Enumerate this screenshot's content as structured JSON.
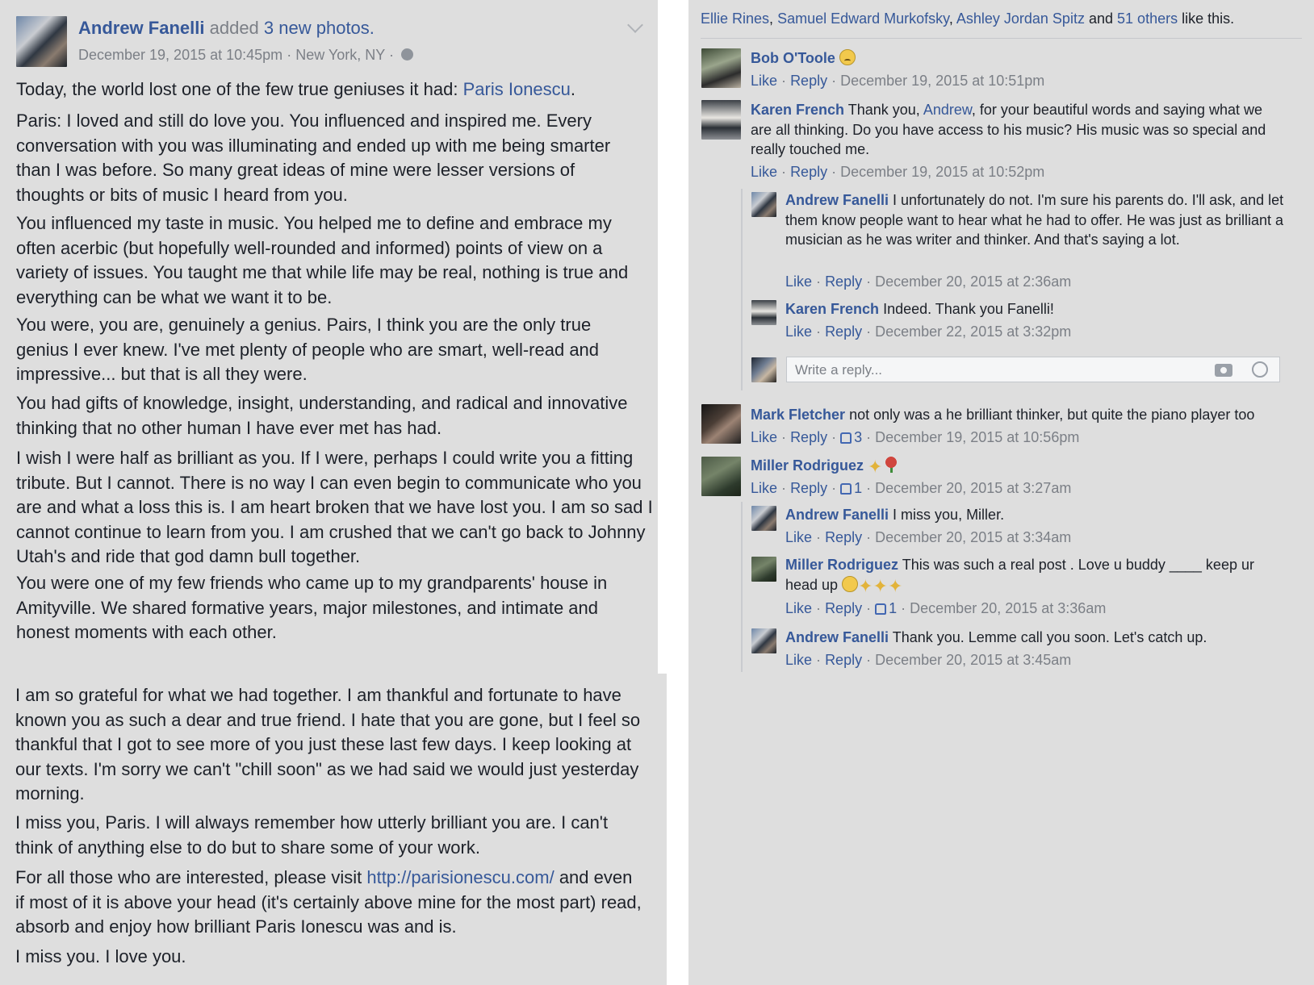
{
  "post": {
    "author": "Andrew Fanelli",
    "action_text": "added",
    "photos_text": "3 new photos.",
    "date": "December 19, 2015 at 10:45pm",
    "location": "New York, NY",
    "separator": "·",
    "paragraphs": {
      "p1_text": "Today, the world lost one of the few true geniuses it had:",
      "p1_link": "Paris Ionescu",
      "p1_end": ".",
      "p2": "Paris: I loved and still do love you. You influenced and inspired me. Every conversation with you was illuminating and ended up with me being smarter than I was before. So many great ideas of mine were lesser versions of thoughts or bits of music I heard from you.",
      "p3": "You influenced my taste in music. You helped me to define and embrace my often acerbic (but hopefully well-rounded and informed) points of view on a variety of issues. You taught me that while life may be real, nothing is true and everything can be what we want it to be.",
      "p4": "You were, you are, genuinely a genius. Pairs, I think you are the only true genius I ever knew. I've met plenty of people who are smart, well-read and impressive... but that is all they were.",
      "p5": "You had gifts of knowledge, insight, understanding, and radical and innovative thinking that no other human I have ever met has had.",
      "p6": "I wish I were half as brilliant as you. If I were, perhaps I could write you a fitting tribute. But I cannot. There is no way I can even begin to communicate who you are and what a loss this is. I am heart broken that we have lost you. I am so sad I cannot continue to learn from you. I am crushed that we can't go back to Johnny Utah's and ride that god damn bull together.",
      "p7": "You were one of my few friends who came up to my grandparents' house in Amityville. We shared formative years, major milestones, and intimate and honest moments with each other.",
      "p8": "I am so grateful for what we had together. I am thankful and fortunate to have known you as such a dear and true friend. I hate that you are gone, but I feel so thankful that I got to see more of you just these last few days. I keep looking at our texts. I'm sorry we can't \"chill soon\" as we had said we would just yesterday morning.",
      "p9": "I miss you, Paris. I will always remember how utterly brilliant you are. I can't think of anything else to do but to share some of your work.",
      "p10_start": "For all those who are interested, please visit",
      "p10_link": "http://parisionescu.com/",
      "p10_end": "and even if most of it is above your head (it's certainly above mine for the most part) read, absorb and enjoy how brilliant Paris Ionescu was and is.",
      "p11": "I miss you. I love you."
    }
  },
  "likes": {
    "name1": "Ellie Rines",
    "comma": ",",
    "name2": "Samuel Edward Murkofsky",
    "name3": "Ashley Jordan Spitz",
    "and_text": "and",
    "others": "51 others",
    "suffix": "like this."
  },
  "actions": {
    "like": "Like",
    "reply": "Reply",
    "dot": "·"
  },
  "comments": [
    {
      "author": "Bob O'Toole",
      "text": "",
      "time": "December 19, 2015 at 10:51pm",
      "emoji": "sad-face-icon"
    },
    {
      "author": "Karen French",
      "text_a": "Thank you,",
      "mention": "Andrew",
      "text_b": ", for your beautiful words and saying what we are all thinking. Do you have access to his music? His music was so special and really touched me.",
      "time": "December 19, 2015 at 10:52pm",
      "replies": [
        {
          "author": "Andrew Fanelli",
          "text": "I unfortunately do not. I'm sure his parents do. I'll ask, and let them know people want to hear what he had to offer. He was just as brilliant a musician as he was writer and thinker. And that's saying a lot.",
          "time": "December 20, 2015 at 2:36am"
        },
        {
          "author": "Karen French",
          "text": "Indeed. Thank you Fanelli!",
          "time": "December 22, 2015 at 3:32pm"
        }
      ],
      "reply_placeholder": "Write a reply..."
    },
    {
      "author": "Mark Fletcher",
      "text": "not only was a he brilliant thinker, but quite the piano player too",
      "likes": "3",
      "time": "December 19, 2015 at 10:56pm"
    },
    {
      "author": "Miller Rodriguez",
      "text": "",
      "likes": "1",
      "time": "December 20, 2015 at 3:27am",
      "replies": [
        {
          "author": "Andrew Fanelli",
          "text": "I miss you, Miller.",
          "time": "December 20, 2015 at 3:34am"
        },
        {
          "author": "Miller Rodriguez",
          "text_a": "This was such a real post . Love u buddy ____ keep ur",
          "text_b": "head up",
          "likes": "1",
          "time": "December 20, 2015 at 3:36am"
        },
        {
          "author": "Andrew Fanelli",
          "text": "Thank you. Lemme call you soon. Let's catch up.",
          "time": "December 20, 2015 at 3:45am"
        }
      ]
    }
  ],
  "colors": {
    "panel": "#dedede",
    "link": "#365899",
    "text": "#1d2129",
    "meta": "#7b7f86"
  }
}
